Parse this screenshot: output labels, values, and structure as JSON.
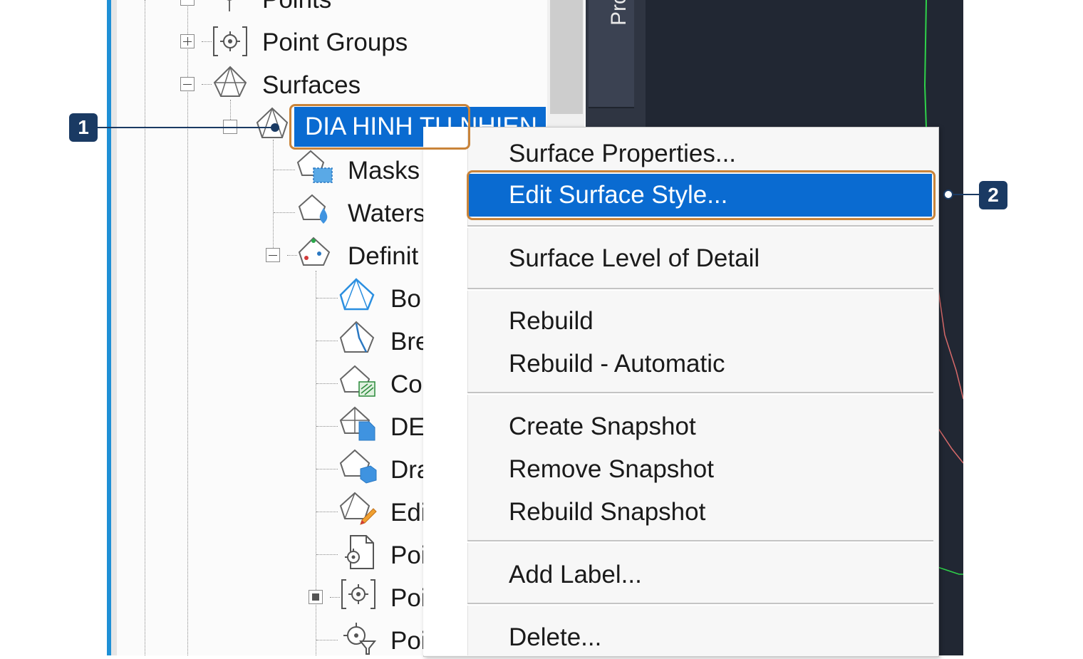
{
  "tree": {
    "items": {
      "points": "Points",
      "point_groups": "Point Groups",
      "surfaces": "Surfaces",
      "surface_selected": "DIA HINH TU NHIEN",
      "masks": "Masks",
      "watersheds": "Waters",
      "definition": "Definit",
      "boundaries": "Bo",
      "breaklines": "Bre",
      "contours": "Co",
      "dem_files": "DE",
      "drawing_objects": "Dra",
      "edits": "Edi",
      "point_files": "Poi",
      "point_groups_child": "Poi",
      "point_survey": "Poi"
    }
  },
  "side_tab": {
    "label": "Pro"
  },
  "context_menu": {
    "surface_properties": "Surface Properties...",
    "edit_surface_style": "Edit Surface Style...",
    "surface_level_of_detail": "Surface Level of Detail",
    "rebuild": "Rebuild",
    "rebuild_automatic": "Rebuild - Automatic",
    "create_snapshot": "Create Snapshot",
    "remove_snapshot": "Remove Snapshot",
    "rebuild_snapshot": "Rebuild Snapshot",
    "add_label": "Add Label...",
    "delete": "Delete..."
  },
  "callouts": {
    "one": "1",
    "two": "2"
  },
  "colors": {
    "selection": "#0a6bd1",
    "callout_box": "#c9843a",
    "badge": "#1a3a63",
    "accent_stripe": "#1e90d6"
  }
}
